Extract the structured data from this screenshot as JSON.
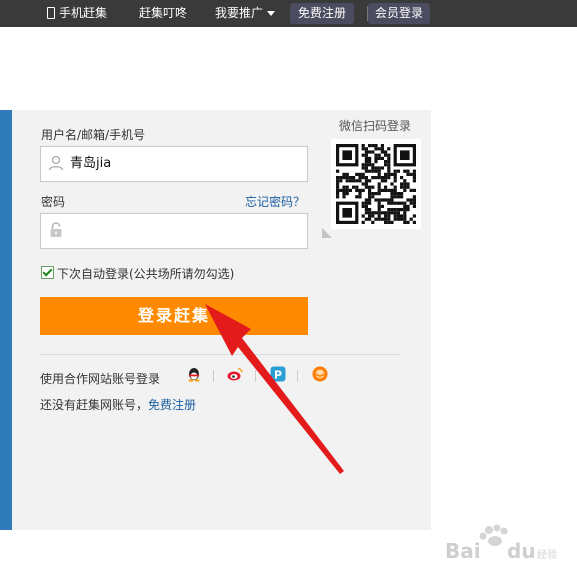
{
  "nav": {
    "mobile": "手机赶集",
    "dingdong": "赶集叮咚",
    "promote": "我要推广",
    "register": "免费注册",
    "member_login": "会员登录"
  },
  "login": {
    "username_label": "用户名/邮箱/手机号",
    "username_value": "青岛jia",
    "password_label": "密码",
    "forgot_link": "忘记密码？",
    "remember_label": "下次自动登录(公共场所请勿勾选)",
    "remember_checked": true,
    "submit_label": "登录赶集",
    "partner_label": "使用合作网站账号登录",
    "partners": [
      "qq-icon",
      "weibo-icon",
      "pp-icon",
      "taobao-icon"
    ],
    "no_account_text": "还没有赶集网账号，",
    "register_link": "免费注册"
  },
  "wechat": {
    "title": "微信扫码登录"
  },
  "watermark": {
    "text": "Bai du 经验"
  },
  "colors": {
    "topbar": "#3a3a3a",
    "button": "#ff8a00",
    "link": "#1a5fa0",
    "arrow": "#e31b1b",
    "blue_strip": "#2f7ab8"
  }
}
